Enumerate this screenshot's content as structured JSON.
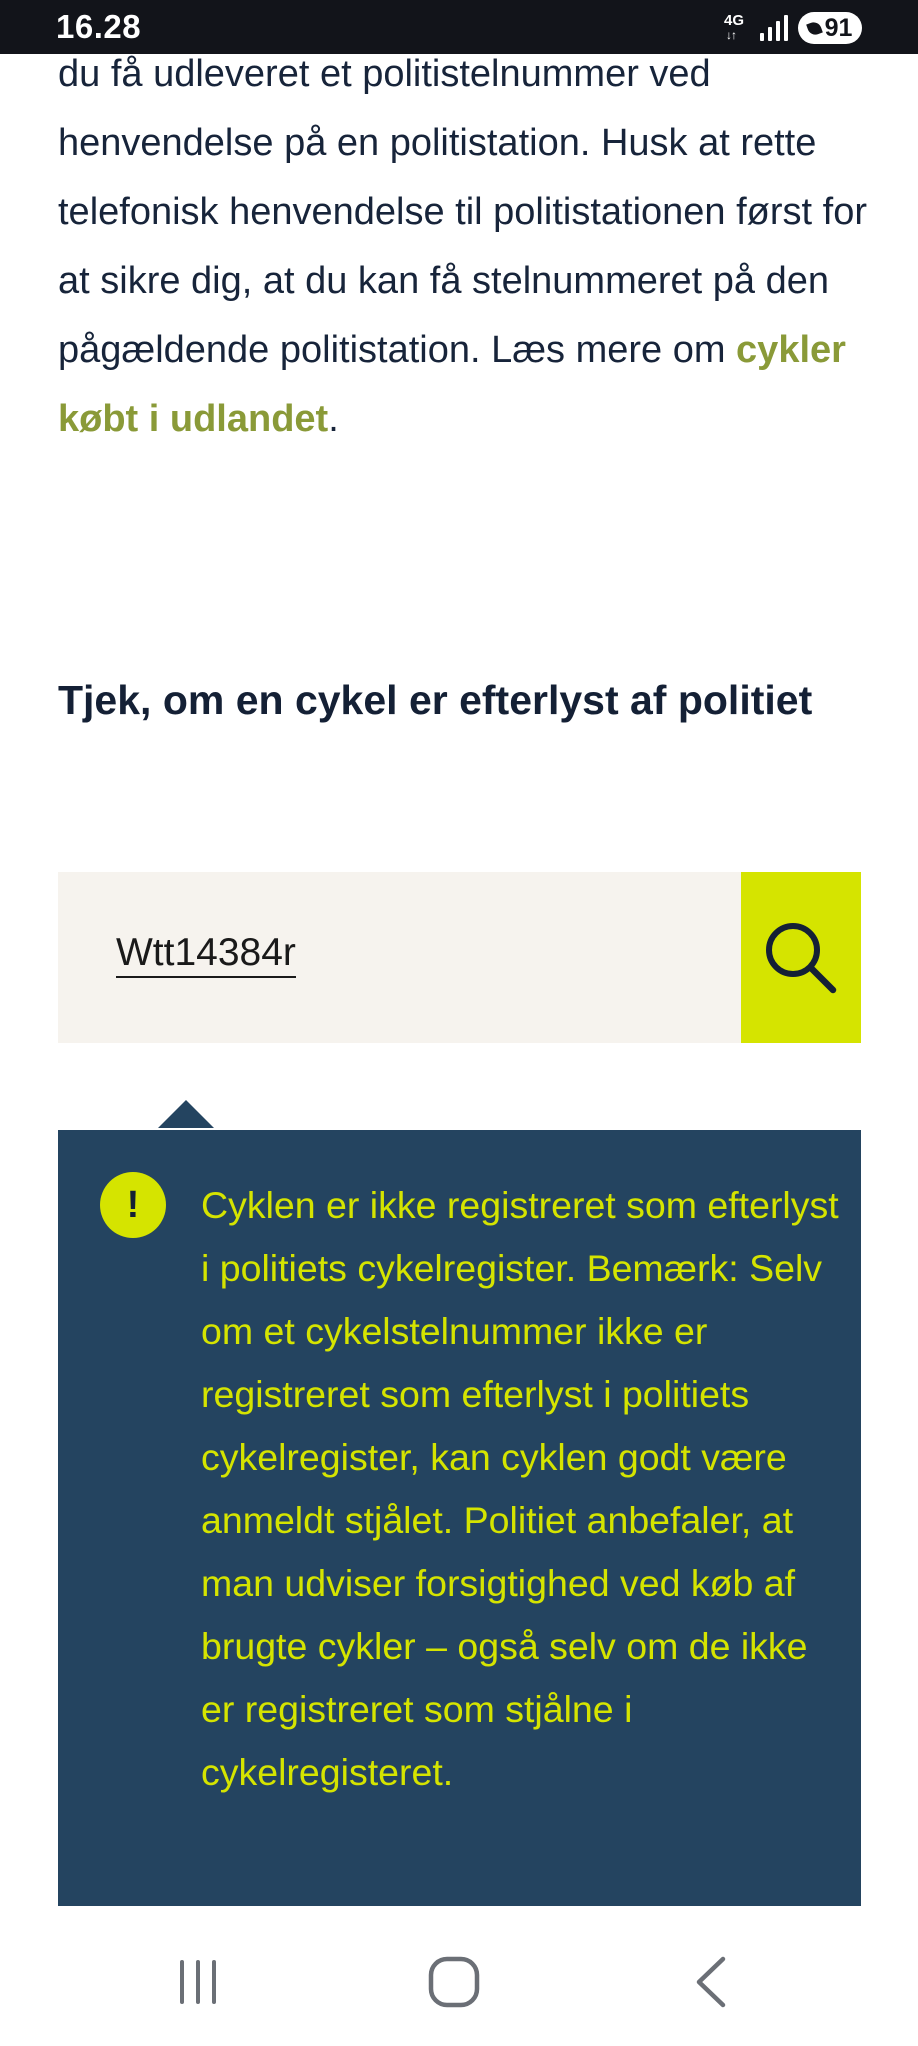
{
  "status_bar": {
    "time": "16.28",
    "network": "4G",
    "battery": "91"
  },
  "intro": {
    "text_before": "du få udleveret et politistelnummer ved henvendelse på en politistation. Husk at rette telefonisk henvendelse til politistationen først for at sikre dig, at du kan få stelnummeret på den pågældende politistation. Læs mere om ",
    "link_label": "cykler købt i udlandet",
    "text_after": "."
  },
  "search_section": {
    "heading": "Tjek, om en cykel er efterlyst af politiet",
    "input_value": "Wtt14384r"
  },
  "alert": {
    "icon_symbol": "!",
    "message": "Cyklen er ikke registreret som efterlyst i politiets cykelregister. Bemærk: Selv om et cykelstelnummer ikke er registreret som efterlyst i politiets cykelregister, kan cyklen godt være anmeldt stjålet. Politiet anbefaler, at man udviser forsigtighed ved køb af brugte cykler – også selv om de ikke er registreret som stjålne i cykelregisteret."
  },
  "colors": {
    "accent_lime": "#d5e400",
    "alert_background": "#244460",
    "link_olive": "#8a9a38",
    "heading_navy": "#142035"
  },
  "icons": {
    "search": "search-icon",
    "alert": "exclamation-icon",
    "nav_recents": "recent-apps-icon",
    "nav_home": "home-icon",
    "nav_back": "back-icon"
  }
}
